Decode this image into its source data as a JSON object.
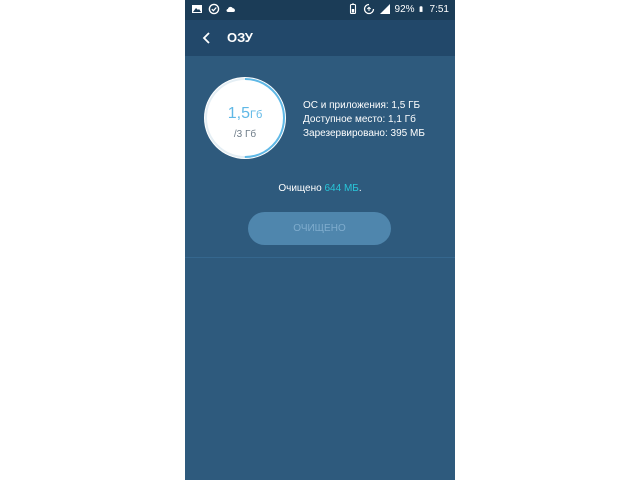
{
  "status_bar": {
    "battery": "92%",
    "time": "7:51"
  },
  "app_bar": {
    "title": "ОЗУ"
  },
  "memory": {
    "used_value": "1,5",
    "used_unit": "Гб",
    "total": "/3 Гб",
    "used_fraction": 0.5
  },
  "details": {
    "os_apps": "ОС и приложения: 1,5 ГБ",
    "available": "Доступное место: 1,1 Гб",
    "reserved": "Зарезервировано: 395 МБ"
  },
  "result": {
    "prefix": "Очищено ",
    "amount": "644 МБ",
    "suffix": "."
  },
  "button": {
    "label": "ОЧИЩЕНО"
  },
  "colors": {
    "background": "#2e5a7d",
    "appbar": "#22486a",
    "accent": "#29c6d9",
    "gauge_text": "#5fb8e6"
  }
}
